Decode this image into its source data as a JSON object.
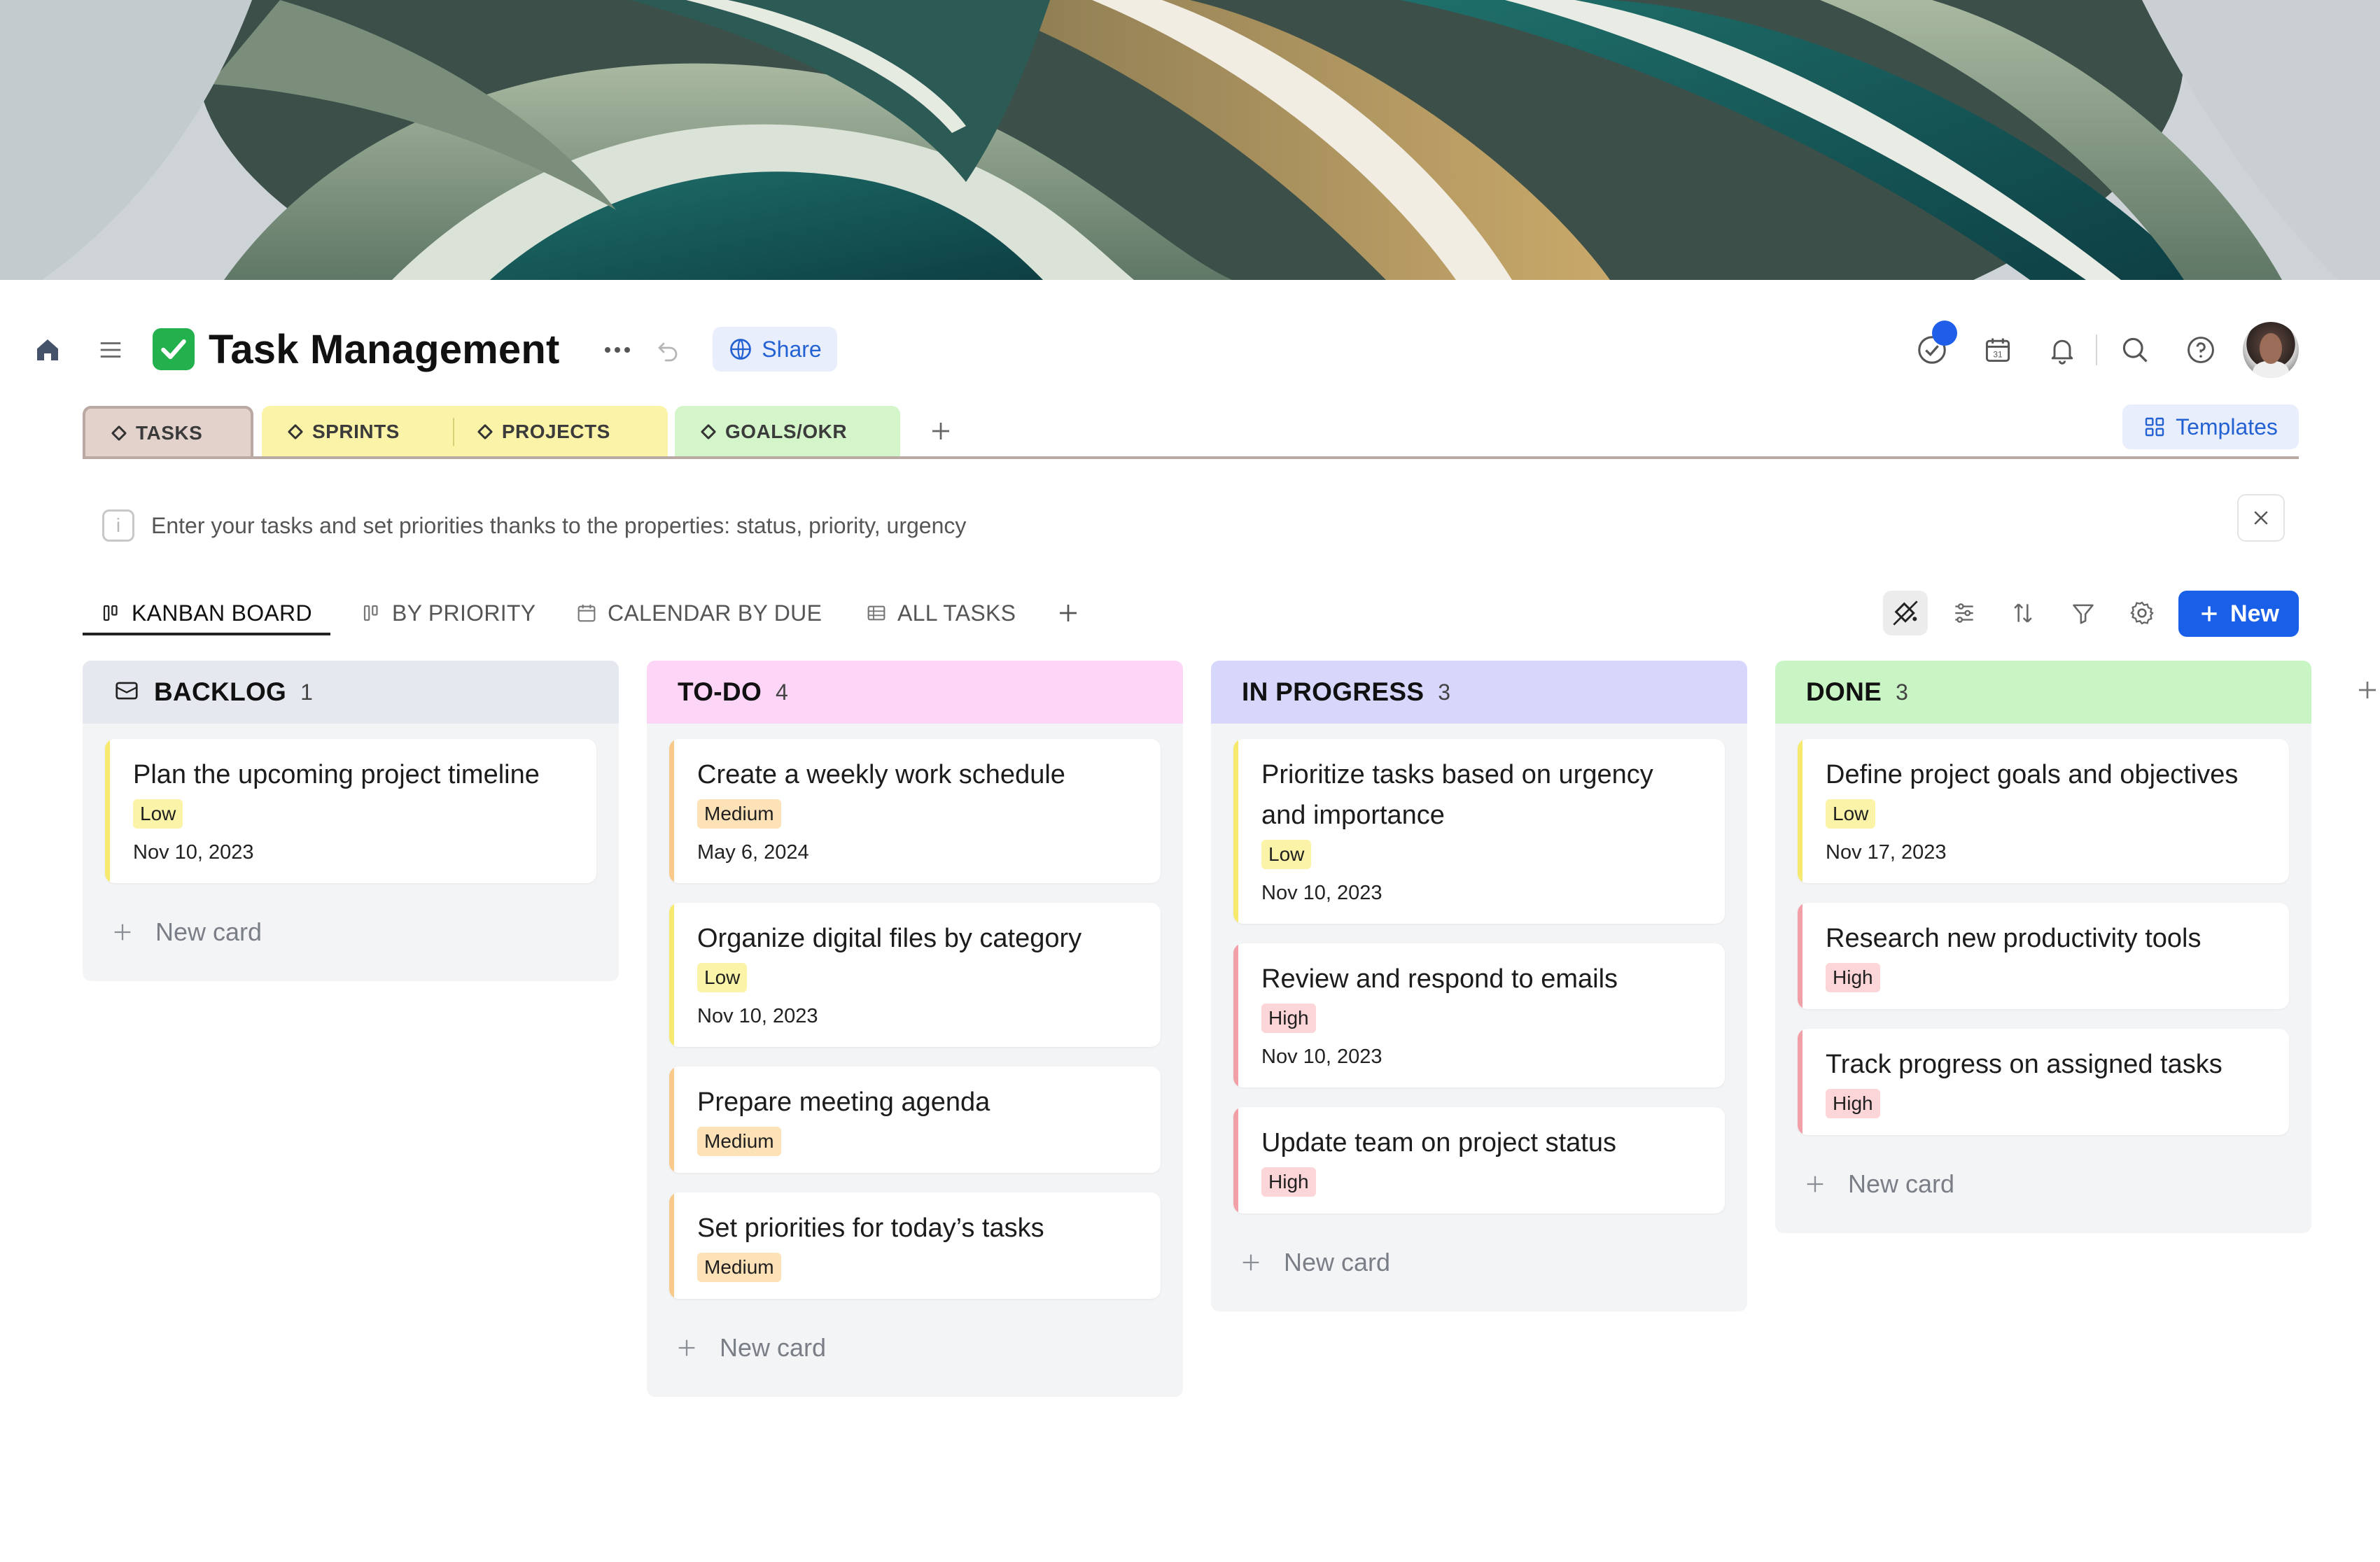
{
  "header": {
    "title": "Task Management",
    "share_label": "Share"
  },
  "top_tabs": [
    {
      "label": "TASKS",
      "color": "#e2d2cb"
    },
    {
      "label": "SPRINTS",
      "color": "#fbf3a7"
    },
    {
      "label": "PROJECTS",
      "color": "#fbf3a7"
    },
    {
      "label": "GOALS/OKR",
      "color": "#d3f5c9"
    }
  ],
  "templates_label": "Templates",
  "hint": "Enter your tasks and set priorities thanks to the properties: status, priority, urgency",
  "views": [
    {
      "label": "KANBAN BOARD",
      "active": true
    },
    {
      "label": "BY PRIORITY"
    },
    {
      "label": "CALENDAR BY DUE"
    },
    {
      "label": "ALL TASKS"
    }
  ],
  "new_label": "New",
  "priority_colors": {
    "Low": {
      "bg": "#fbf3a7",
      "bar": "#f7e96d"
    },
    "Medium": {
      "bg": "#fde2b8",
      "bar": "#f8c98a"
    },
    "High": {
      "bg": "#fbd5d8",
      "bar": "#f2a0a8"
    }
  },
  "columns": [
    {
      "title": "BACKLOG",
      "count": "1",
      "color": "#e6e8ef",
      "cards": [
        {
          "title": "Plan the upcoming project timeline",
          "priority": "Low",
          "date": "Nov 10, 2023"
        }
      ],
      "new_card": "New card"
    },
    {
      "title": "TO-DO",
      "count": "4",
      "color": "#fdd5f7",
      "cards": [
        {
          "title": "Create a weekly work schedule",
          "priority": "Medium",
          "date": "May 6, 2024"
        },
        {
          "title": "Organize digital files by category",
          "priority": "Low",
          "date": "Nov 10, 2023"
        },
        {
          "title": "Prepare meeting agenda",
          "priority": "Medium",
          "date": ""
        },
        {
          "title": "Set priorities for today’s tasks",
          "priority": "Medium",
          "date": ""
        }
      ],
      "new_card": "New card"
    },
    {
      "title": "IN PROGRESS",
      "count": "3",
      "color": "#d7d7fc",
      "cards": [
        {
          "title": "Prioritize tasks based on urgency and importance",
          "priority": "Low",
          "date": "Nov 10, 2023"
        },
        {
          "title": "Review and respond to emails",
          "priority": "High",
          "date": "Nov 10, 2023"
        },
        {
          "title": "Update team on project status",
          "priority": "High",
          "date": ""
        }
      ],
      "new_card": "New card"
    },
    {
      "title": "DONE",
      "count": "3",
      "color": "#c9f5c4",
      "cards": [
        {
          "title": "Define project goals and objectives",
          "priority": "Low",
          "date": "Nov 17, 2023"
        },
        {
          "title": "Research new productivity tools",
          "priority": "High",
          "date": ""
        },
        {
          "title": "Track progress on assigned tasks",
          "priority": "High",
          "date": ""
        }
      ],
      "new_card": "New card"
    }
  ]
}
